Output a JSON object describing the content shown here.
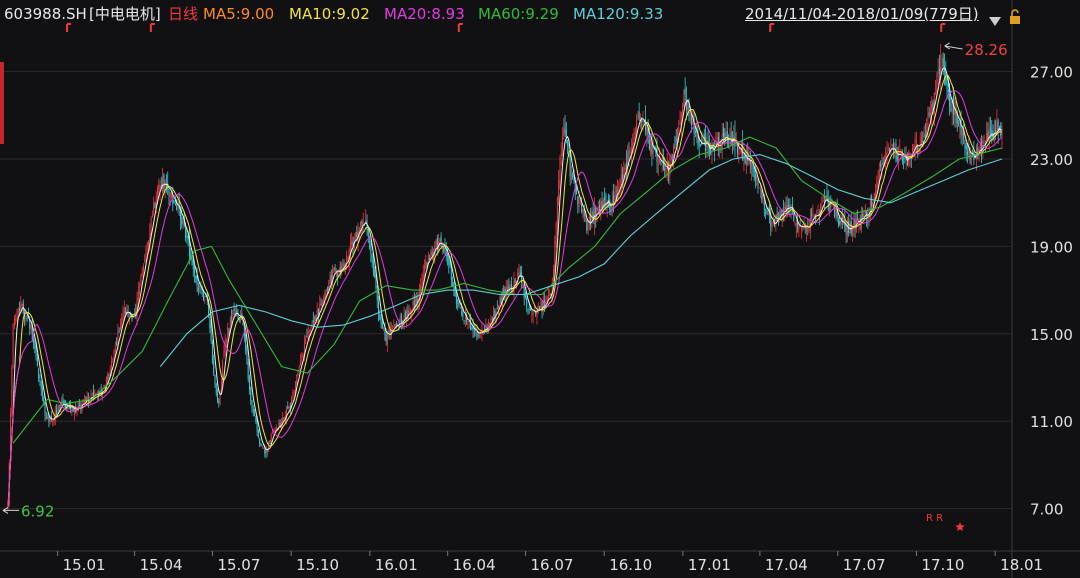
{
  "header": {
    "symbol": "603988.SH",
    "name": "[中电电机]",
    "period": "日线",
    "ma5": "MA5:9.00",
    "ma10": "MA10:9.02",
    "ma20": "MA20:8.93",
    "ma60": "MA60:9.29",
    "ma120": "MA120:9.33",
    "date_range": "2014/11/04-2018/01/09(779日)",
    "dropdown_icon": "triangle-down-icon",
    "lock_icon": "lock-icon"
  },
  "colors": {
    "background": "#111113",
    "grid": "#2a2a2e",
    "up": "#e8383b",
    "down": "#2ed0d6",
    "ma5": "#f0f0f0",
    "ma10": "#f2e43c",
    "ma20": "#e03ce0",
    "ma60": "#34b93a",
    "ma120": "#5fcfd6",
    "label_max": "#f04040",
    "label_min": "#3ec43e",
    "axis_text": "#e0e0e0",
    "symbol": "#e8e8e8",
    "period": "#f03a3a",
    "ma5_text": "#ff8a1e"
  },
  "annotations": {
    "max_label": "28.26",
    "min_label": "6.92",
    "marker_text": "R R",
    "marker_icon": "star-icon"
  },
  "chart_data": {
    "type": "candlestick",
    "ylim": [
      5.2,
      28.9
    ],
    "y_ticks": [
      "27.00",
      "23.00",
      "19.00",
      "15.00",
      "11.00",
      "7.00"
    ],
    "y_tick_values": [
      27,
      23,
      19,
      15,
      11,
      7
    ],
    "x_ticks": [
      "15.01",
      "15.04",
      "15.07",
      "15.10",
      "16.01",
      "16.04",
      "16.07",
      "16.10",
      "17.01",
      "17.04",
      "17.07",
      "17.10",
      "18.01"
    ],
    "date_start": "2014/11/04",
    "date_end": "2018/01/09",
    "bar_count": 779,
    "max": {
      "value": 28.26,
      "date": "2017-10-30"
    },
    "min": {
      "value": 6.92,
      "date": "2014-11-04"
    },
    "close_path": [
      [
        "2014-11-04",
        7.0
      ],
      [
        "2014-11-10",
        15.5
      ],
      [
        "2014-11-20",
        16.2
      ],
      [
        "2014-12-01",
        15.3
      ],
      [
        "2014-12-10",
        13.0
      ],
      [
        "2014-12-18",
        11.2
      ],
      [
        "2014-12-25",
        11.0
      ],
      [
        "2015-01-05",
        11.8
      ],
      [
        "2015-01-20",
        11.5
      ],
      [
        "2015-02-05",
        12.0
      ],
      [
        "2015-02-25",
        12.5
      ],
      [
        "2015-03-10",
        14.5
      ],
      [
        "2015-03-20",
        16.0
      ],
      [
        "2015-04-01",
        15.8
      ],
      [
        "2015-04-10",
        18.0
      ],
      [
        "2015-04-20",
        20.0
      ],
      [
        "2015-05-01",
        22.0
      ],
      [
        "2015-05-10",
        21.5
      ],
      [
        "2015-05-20",
        21.0
      ],
      [
        "2015-06-01",
        19.5
      ],
      [
        "2015-06-08",
        18.0
      ],
      [
        "2015-06-15",
        17.0
      ],
      [
        "2015-06-25",
        16.5
      ],
      [
        "2015-07-03",
        13.0
      ],
      [
        "2015-07-08",
        11.5
      ],
      [
        "2015-07-15",
        14.5
      ],
      [
        "2015-07-25",
        16.2
      ],
      [
        "2015-08-05",
        15.5
      ],
      [
        "2015-08-15",
        12.0
      ],
      [
        "2015-08-25",
        10.0
      ],
      [
        "2015-09-01",
        9.5
      ],
      [
        "2015-09-10",
        10.5
      ],
      [
        "2015-09-20",
        11.0
      ],
      [
        "2015-10-01",
        11.8
      ],
      [
        "2015-10-10",
        13.5
      ],
      [
        "2015-10-20",
        15.0
      ],
      [
        "2015-11-01",
        16.0
      ],
      [
        "2015-11-10",
        17.0
      ],
      [
        "2015-11-20",
        17.8
      ],
      [
        "2015-12-01",
        18.0
      ],
      [
        "2015-12-10",
        19.0
      ],
      [
        "2015-12-20",
        20.0
      ],
      [
        "2015-12-28",
        20.0
      ],
      [
        "2016-01-05",
        18.0
      ],
      [
        "2016-01-12",
        15.5
      ],
      [
        "2016-01-20",
        14.8
      ],
      [
        "2016-01-28",
        15.2
      ],
      [
        "2016-02-15",
        16.0
      ],
      [
        "2016-02-25",
        16.5
      ],
      [
        "2016-03-05",
        18.0
      ],
      [
        "2016-03-15",
        19.0
      ],
      [
        "2016-03-25",
        19.2
      ],
      [
        "2016-04-01",
        18.5
      ],
      [
        "2016-04-10",
        16.5
      ],
      [
        "2016-04-20",
        15.8
      ],
      [
        "2016-05-01",
        15.2
      ],
      [
        "2016-05-10",
        15.0
      ],
      [
        "2016-05-20",
        15.5
      ],
      [
        "2016-06-01",
        16.5
      ],
      [
        "2016-06-10",
        17.0
      ],
      [
        "2016-06-20",
        17.5
      ],
      [
        "2016-06-25",
        17.8
      ],
      [
        "2016-07-01",
        16.5
      ],
      [
        "2016-07-10",
        16.0
      ],
      [
        "2016-07-20",
        16.2
      ],
      [
        "2016-08-01",
        16.8
      ],
      [
        "2016-08-08",
        22.0
      ],
      [
        "2016-08-15",
        24.5
      ],
      [
        "2016-08-22",
        22.5
      ],
      [
        "2016-09-01",
        21.0
      ],
      [
        "2016-09-10",
        20.0
      ],
      [
        "2016-09-20",
        20.5
      ],
      [
        "2016-10-01",
        21.0
      ],
      [
        "2016-10-10",
        20.8
      ],
      [
        "2016-10-20",
        22.0
      ],
      [
        "2016-11-01",
        23.5
      ],
      [
        "2016-11-10",
        25.0
      ],
      [
        "2016-11-18",
        24.5
      ],
      [
        "2016-11-25",
        23.5
      ],
      [
        "2016-12-05",
        23.0
      ],
      [
        "2016-12-15",
        22.5
      ],
      [
        "2016-12-25",
        24.0
      ],
      [
        "2017-01-03",
        26.0
      ],
      [
        "2017-01-10",
        24.5
      ],
      [
        "2017-01-20",
        23.8
      ],
      [
        "2017-02-05",
        23.5
      ],
      [
        "2017-02-15",
        24.0
      ],
      [
        "2017-03-01",
        23.8
      ],
      [
        "2017-03-15",
        23.0
      ],
      [
        "2017-03-25",
        22.5
      ],
      [
        "2017-04-05",
        21.0
      ],
      [
        "2017-04-15",
        20.0
      ],
      [
        "2017-04-25",
        20.5
      ],
      [
        "2017-05-05",
        20.8
      ],
      [
        "2017-05-15",
        20.0
      ],
      [
        "2017-05-25",
        19.8
      ],
      [
        "2017-06-05",
        20.5
      ],
      [
        "2017-06-15",
        21.0
      ],
      [
        "2017-06-25",
        20.8
      ],
      [
        "2017-07-05",
        20.0
      ],
      [
        "2017-07-15",
        19.8
      ],
      [
        "2017-07-25",
        20.2
      ],
      [
        "2017-08-05",
        20.5
      ],
      [
        "2017-08-15",
        21.5
      ],
      [
        "2017-08-22",
        23.0
      ],
      [
        "2017-09-01",
        23.5
      ],
      [
        "2017-09-10",
        23.2
      ],
      [
        "2017-09-20",
        23.0
      ],
      [
        "2017-09-28",
        23.5
      ],
      [
        "2017-10-10",
        24.0
      ],
      [
        "2017-10-20",
        25.5
      ],
      [
        "2017-10-30",
        27.5
      ],
      [
        "2017-11-06",
        26.0
      ],
      [
        "2017-11-15",
        25.0
      ],
      [
        "2017-11-25",
        24.0
      ],
      [
        "2017-12-05",
        23.0
      ],
      [
        "2017-12-15",
        23.5
      ],
      [
        "2017-12-25",
        24.0
      ],
      [
        "2018-01-05",
        24.5
      ],
      [
        "2018-01-09",
        24.2
      ]
    ],
    "series": [
      {
        "name": "MA60",
        "values": [
          [
            "2014-11-10",
            10.0
          ],
          [
            "2014-12-20",
            12.0
          ],
          [
            "2015-01-10",
            11.8
          ],
          [
            "2015-02-10",
            12.0
          ],
          [
            "2015-03-10",
            13.0
          ],
          [
            "2015-04-10",
            14.2
          ],
          [
            "2015-05-10",
            16.5
          ],
          [
            "2015-06-10",
            18.8
          ],
          [
            "2015-06-30",
            19.0
          ],
          [
            "2015-07-20",
            17.5
          ],
          [
            "2015-08-20",
            15.5
          ],
          [
            "2015-09-20",
            13.5
          ],
          [
            "2015-10-20",
            13.2
          ],
          [
            "2015-11-20",
            14.5
          ],
          [
            "2015-12-20",
            16.5
          ],
          [
            "2016-01-20",
            17.2
          ],
          [
            "2016-02-20",
            17.0
          ],
          [
            "2016-03-20",
            17.0
          ],
          [
            "2016-04-20",
            17.3
          ],
          [
            "2016-05-20",
            17.0
          ],
          [
            "2016-06-20",
            16.8
          ],
          [
            "2016-07-20",
            16.8
          ],
          [
            "2016-08-20",
            18.0
          ],
          [
            "2016-09-20",
            19.0
          ],
          [
            "2016-10-20",
            20.5
          ],
          [
            "2016-11-20",
            21.5
          ],
          [
            "2016-12-20",
            22.5
          ],
          [
            "2017-01-20",
            23.2
          ],
          [
            "2017-02-20",
            23.5
          ],
          [
            "2017-03-20",
            24.0
          ],
          [
            "2017-04-20",
            23.5
          ],
          [
            "2017-05-20",
            22.0
          ],
          [
            "2017-06-20",
            21.2
          ],
          [
            "2017-07-20",
            20.5
          ],
          [
            "2017-08-20",
            20.8
          ],
          [
            "2017-09-20",
            21.5
          ],
          [
            "2017-10-20",
            22.2
          ],
          [
            "2017-11-20",
            23.0
          ],
          [
            "2017-12-20",
            23.3
          ],
          [
            "2018-01-09",
            23.5
          ]
        ]
      },
      {
        "name": "MA120",
        "values": [
          [
            "2015-05-01",
            13.5
          ],
          [
            "2015-06-01",
            15.0
          ],
          [
            "2015-07-01",
            16.0
          ],
          [
            "2015-08-01",
            16.3
          ],
          [
            "2015-09-01",
            16.0
          ],
          [
            "2015-10-01",
            15.6
          ],
          [
            "2015-11-01",
            15.3
          ],
          [
            "2015-12-01",
            15.4
          ],
          [
            "2016-01-01",
            15.8
          ],
          [
            "2016-02-01",
            16.3
          ],
          [
            "2016-03-01",
            16.8
          ],
          [
            "2016-04-01",
            17.0
          ],
          [
            "2016-05-01",
            17.0
          ],
          [
            "2016-06-01",
            16.8
          ],
          [
            "2016-07-01",
            16.8
          ],
          [
            "2016-08-01",
            17.2
          ],
          [
            "2016-09-01",
            17.6
          ],
          [
            "2016-10-01",
            18.2
          ],
          [
            "2016-11-01",
            19.5
          ],
          [
            "2016-12-01",
            20.5
          ],
          [
            "2017-01-01",
            21.5
          ],
          [
            "2017-02-01",
            22.5
          ],
          [
            "2017-03-01",
            23.0
          ],
          [
            "2017-04-01",
            23.2
          ],
          [
            "2017-05-01",
            22.8
          ],
          [
            "2017-06-01",
            22.2
          ],
          [
            "2017-07-01",
            21.6
          ],
          [
            "2017-08-01",
            21.2
          ],
          [
            "2017-09-01",
            21.0
          ],
          [
            "2017-10-01",
            21.5
          ],
          [
            "2017-11-01",
            22.0
          ],
          [
            "2017-12-01",
            22.5
          ],
          [
            "2018-01-09",
            23.0
          ]
        ]
      }
    ]
  }
}
